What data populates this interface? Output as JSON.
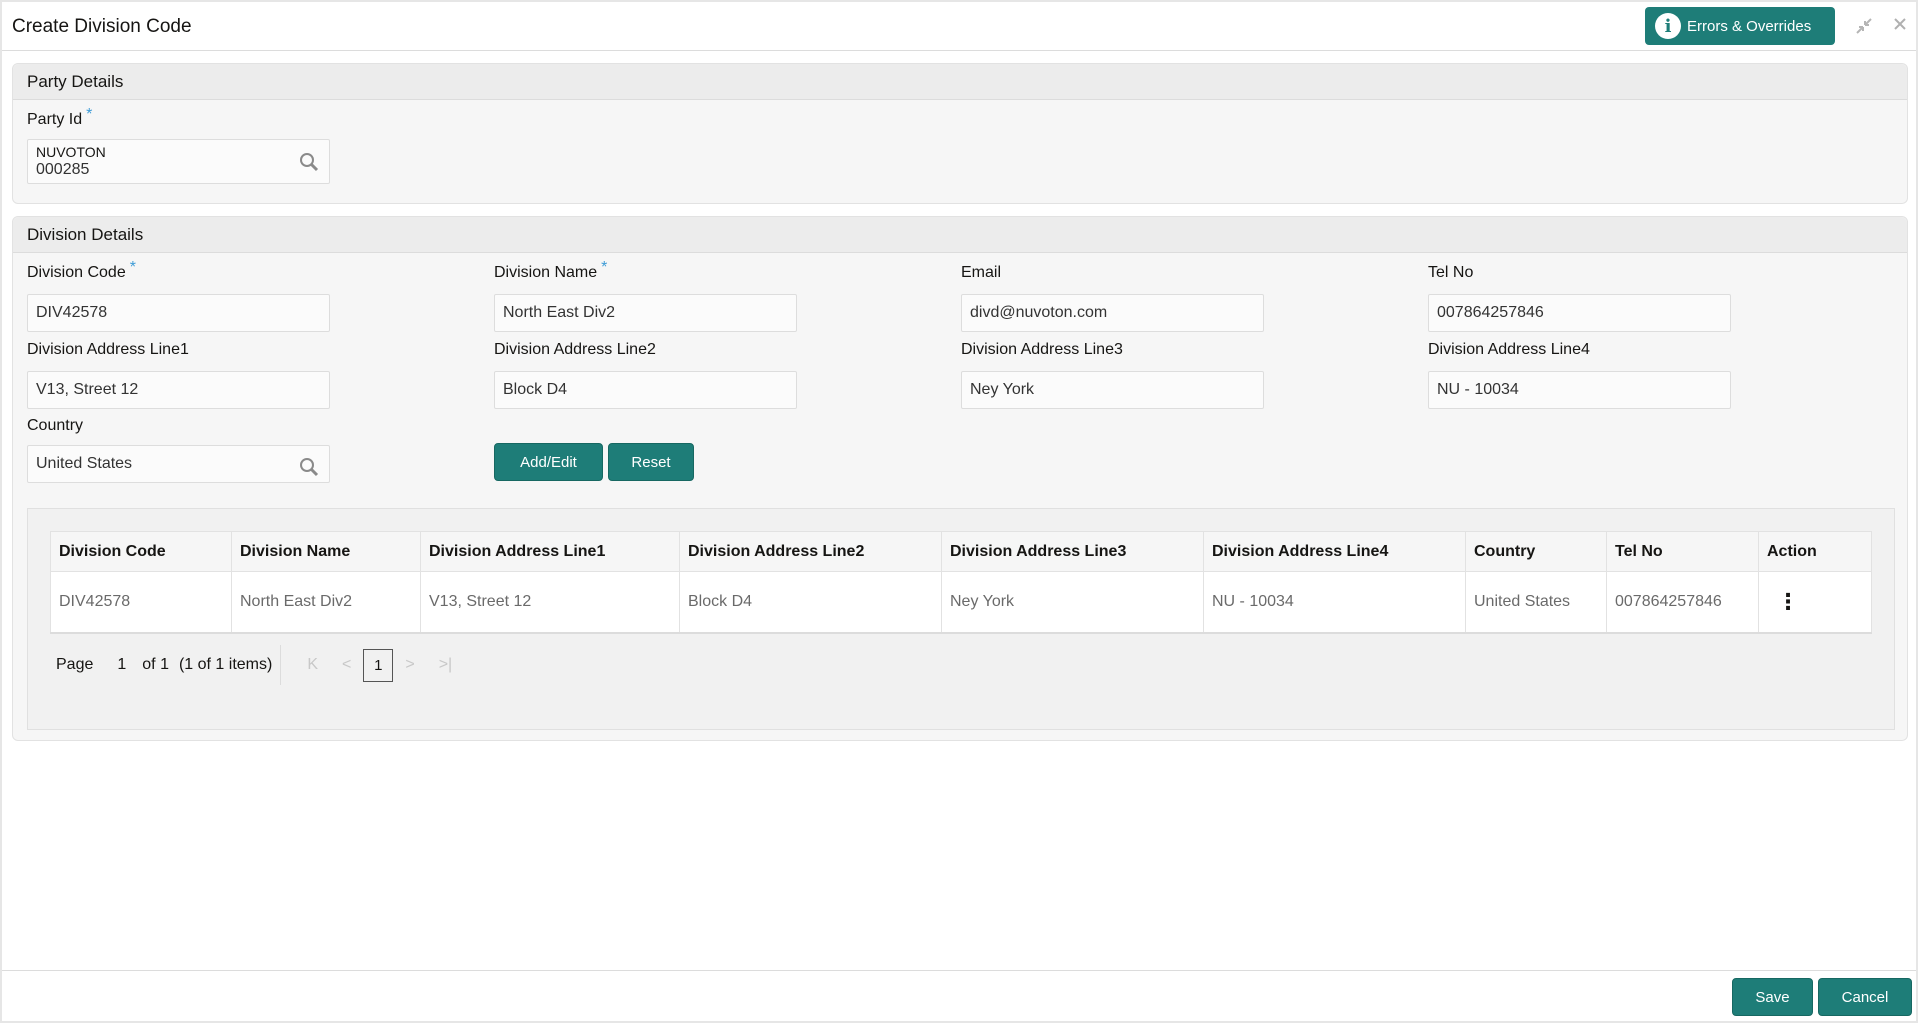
{
  "window": {
    "title": "Create Division Code",
    "errors_button_label": "Errors & Overrides",
    "minimize_icon": "compress-icon",
    "close_icon": "close-icon"
  },
  "party_details": {
    "header": "Party Details",
    "party_id": {
      "label": "Party Id",
      "required": "*",
      "name": "NUVOTON",
      "value": "000285"
    }
  },
  "division_details": {
    "header": "Division Details",
    "fields": {
      "division_code": {
        "label": "Division Code",
        "value": "DIV42578"
      },
      "division_name": {
        "label": "Division Name",
        "value": "North East Div2"
      },
      "email": {
        "label": "Email",
        "value": "divd@nuvoton.com"
      },
      "tel_no": {
        "label": "Tel No",
        "value": "007864257846"
      },
      "address1": {
        "label": "Division Address Line1",
        "value": "V13, Street 12"
      },
      "address2": {
        "label": "Division Address Line2",
        "value": "Block D4"
      },
      "address3": {
        "label": "Division Address Line3",
        "value": "Ney York"
      },
      "address4": {
        "label": "Division Address Line4",
        "value": "NU - 10034"
      },
      "country": {
        "label": "Country",
        "value": "United States"
      }
    },
    "required_marker": "*",
    "add_edit_label": "Add/Edit",
    "reset_label": "Reset"
  },
  "grid": {
    "columns": [
      "Division Code",
      "Division Name",
      "Division Address Line1",
      "Division Address Line2",
      "Division Address Line3",
      "Division Address Line4",
      "Country",
      "Tel No",
      "Action"
    ],
    "rows": [
      [
        "DIV42578",
        "North East Div2",
        "V13, Street 12",
        "Block D4",
        "Ney York",
        "NU - 10034",
        "United States",
        "007864257846",
        "⋮"
      ]
    ],
    "pager": {
      "page_label": "Page",
      "page": "1",
      "of_label": "of 1",
      "items_label": "(1 of 1 items)",
      "current": "1"
    }
  },
  "footer": {
    "save_label": "Save",
    "cancel_label": "Cancel"
  },
  "colors": {
    "accent": "#1e7d78",
    "required": "#3d9bd6"
  }
}
